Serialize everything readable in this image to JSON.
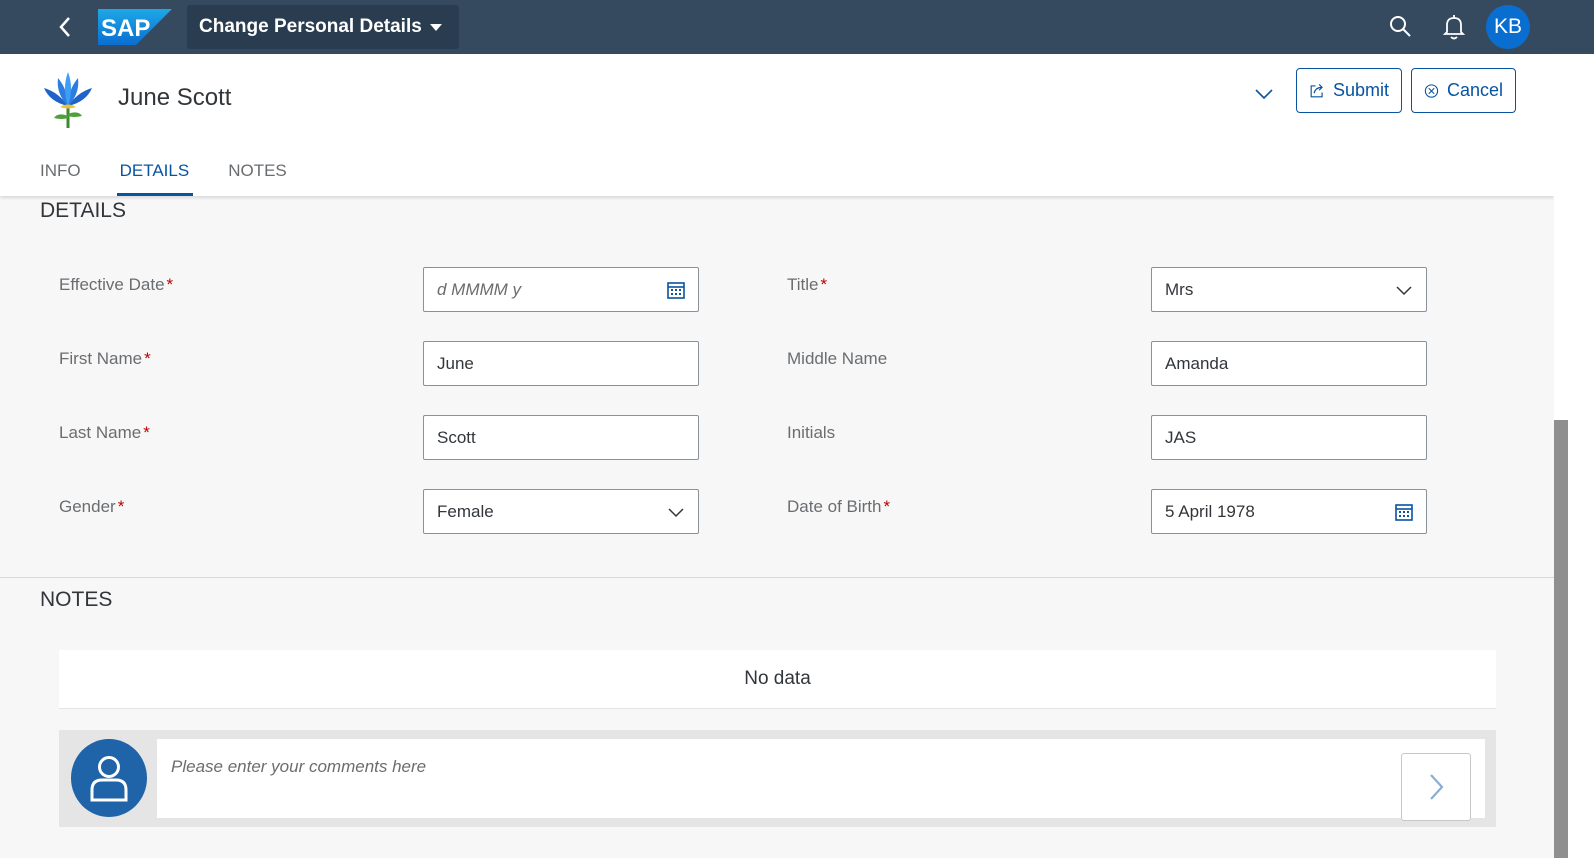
{
  "shell": {
    "app_title": "Change Personal Details",
    "logo_text": "SAP",
    "user_initials": "KB",
    "icons": [
      "back-icon",
      "search-icon",
      "bell-icon"
    ],
    "colors": {
      "shell_bg": "#354a5f",
      "accent": "#0854a0",
      "avatar": "#0a6ed1"
    }
  },
  "header": {
    "name": "June Scott",
    "submit_label": "Submit",
    "cancel_label": "Cancel",
    "tabs": [
      {
        "label": "INFO",
        "active": false
      },
      {
        "label": "DETAILS",
        "active": true
      },
      {
        "label": "NOTES",
        "active": false
      }
    ]
  },
  "details": {
    "title": "DETAILS",
    "fields": {
      "effective_date": {
        "label": "Effective Date",
        "required": "*",
        "value": "",
        "placeholder": "d MMMM y"
      },
      "title": {
        "label": "Title",
        "required": "*",
        "value": "Mrs"
      },
      "first_name": {
        "label": "First Name",
        "required": "*",
        "value": "June"
      },
      "middle_name": {
        "label": "Middle Name",
        "value": "Amanda"
      },
      "last_name": {
        "label": "Last Name",
        "required": "*",
        "value": "Scott"
      },
      "initials": {
        "label": "Initials",
        "value": "JAS"
      },
      "gender": {
        "label": "Gender",
        "required": "*",
        "value": "Female"
      },
      "date_of_birth": {
        "label": "Date of Birth",
        "required": "*",
        "value": "5 April 1978"
      }
    }
  },
  "notes": {
    "title": "NOTES",
    "no_data": "No data",
    "comment_placeholder": "Please enter your comments here"
  }
}
